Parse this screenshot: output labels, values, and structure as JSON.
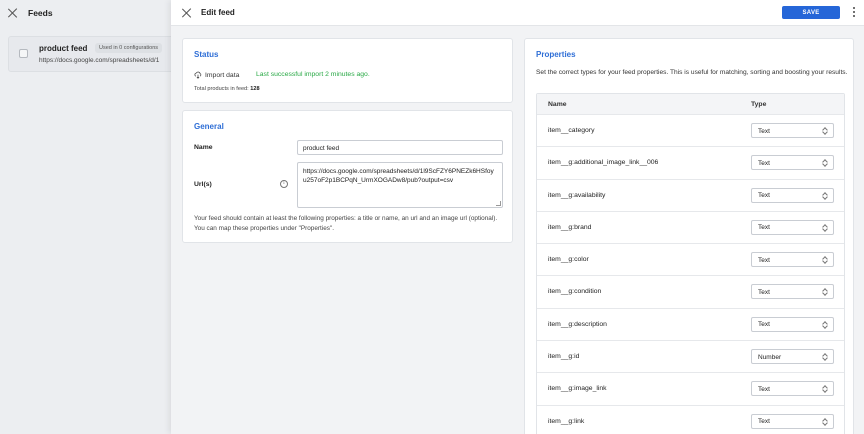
{
  "background": {
    "title": "Feeds",
    "feed_name": "product feed",
    "feed_badge": "Used in 0 configurations",
    "feed_url": "https://docs.google.com/spreadsheets/d/1"
  },
  "drawer": {
    "title": "Edit feed",
    "save_label": "SAVE"
  },
  "status": {
    "title": "Status",
    "import_label": "Import data",
    "import_status": "Last successful import 2 minutes ago.",
    "total_label": "Total products in feed:",
    "total_value": "128"
  },
  "general": {
    "title": "General",
    "name_label": "Name",
    "name_value": "product feed",
    "url_label": "Url(s)",
    "url_value": "https://docs.google.com/spreadsheets/d/1l9ScFZY6PNEZk6HSfoyu257oF2p1BCPqN_UrmXOGADw8/pub?output=csv",
    "help_text": "Your feed should contain at least the following properties: a title or name, an url and an image url (optional). You can map these properties under \"Properties\"."
  },
  "properties": {
    "title": "Properties",
    "description": "Set the correct types for your feed properties. This is useful for matching, sorting and boosting your results.",
    "col_name": "Name",
    "col_type": "Type",
    "rows": [
      {
        "name": "item__category",
        "type": "Text"
      },
      {
        "name": "item__g:additional_image_link__006",
        "type": "Text"
      },
      {
        "name": "item__g:availability",
        "type": "Text"
      },
      {
        "name": "item__g:brand",
        "type": "Text"
      },
      {
        "name": "item__g:color",
        "type": "Text"
      },
      {
        "name": "item__g:condition",
        "type": "Text"
      },
      {
        "name": "item__g:description",
        "type": "Text"
      },
      {
        "name": "item__g:id",
        "type": "Number"
      },
      {
        "name": "item__g:image_link",
        "type": "Text"
      },
      {
        "name": "item__g:link",
        "type": "Text"
      }
    ]
  }
}
